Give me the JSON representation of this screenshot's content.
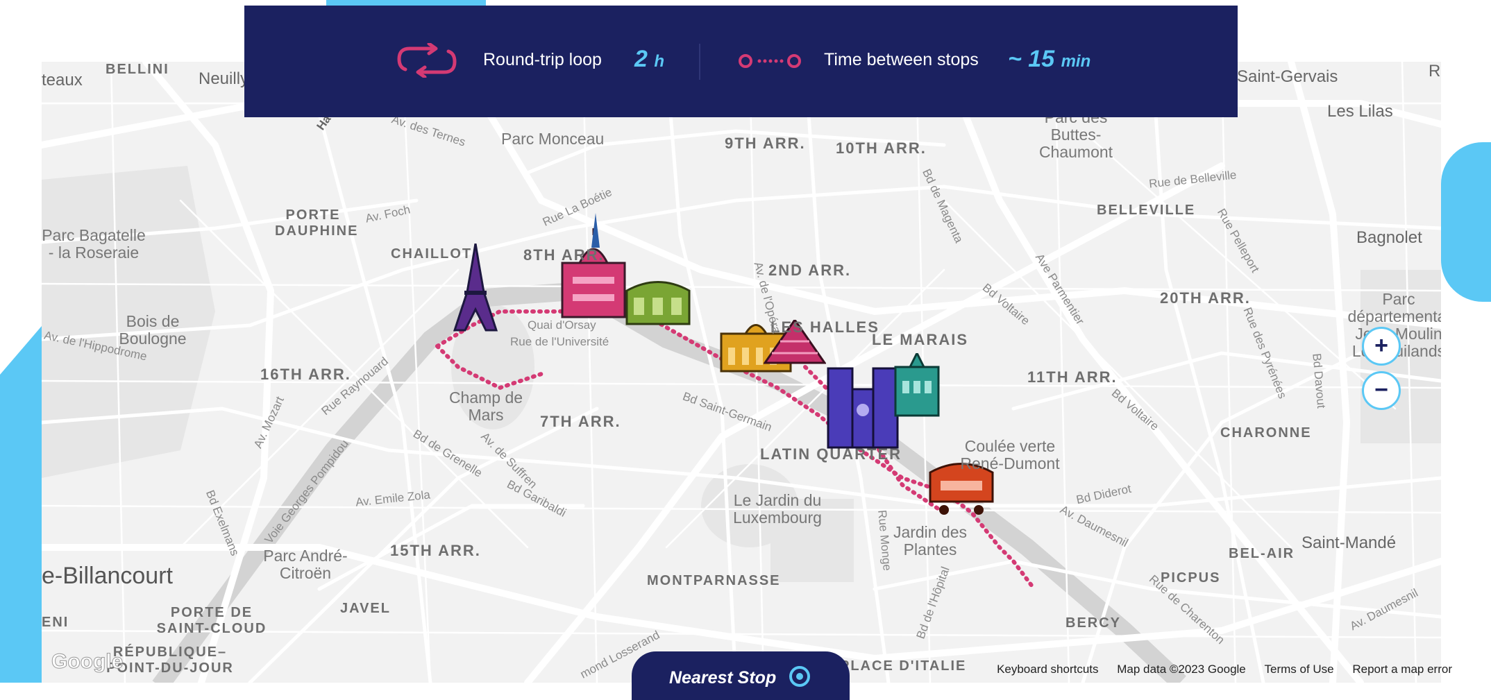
{
  "infobar": {
    "loop_label": "Round-trip loop",
    "loop_value": "2",
    "loop_unit": "h",
    "interval_label": "Time between stops",
    "interval_value": "~ 15",
    "interval_unit": "min",
    "loop_icon": "round-trip-icon",
    "interval_icon": "stops-dots-icon"
  },
  "colors": {
    "navy": "#1b2160",
    "accent": "#5bc8f5",
    "route": "#d43a74"
  },
  "map": {
    "districts": [
      "9TH ARR.",
      "10TH ARR.",
      "8TH ARR.",
      "2ND ARR.",
      "LES HALLES",
      "LE MARAIS",
      "16TH ARR.",
      "7TH ARR.",
      "LATIN QUARTER",
      "11TH ARR.",
      "20TH ARR.",
      "15TH ARR.",
      "MONTPARNASSE",
      "BELLEVILLE",
      "CHARONNE",
      "BEL-AIR",
      "PICPUS",
      "BERCY",
      "CHAILLOT",
      "JAVEL"
    ],
    "places": [
      "Parc Monceau",
      "Parc des Buttes-Chaumont",
      "Parc Bagatelle - la Roseraie",
      "Bois de Boulogne",
      "Champ de Mars",
      "Coulée verte René-Dumont",
      "Le Jardin du Luxembourg",
      "Jardin des Plantes",
      "Parc André-Citroën",
      "Parc départemental Jean-Moulin Les Guilands"
    ],
    "cities": [
      "Saint-Gervais",
      "Les Lilas",
      "Bagnolet",
      "Saint-Mandé",
      "BELLINI",
      "Neuilly",
      "teaux",
      "PORTE DAUPHINE",
      "PORTE DE SAINT-CLOUD",
      "RÉPUBLIQUE– POINT-DU-JOUR",
      "ENI",
      "e-Billancourt",
      "PLACE D'ITALIE",
      "R"
    ],
    "streets": [
      "Av. des Ternes",
      "Av. Foch",
      "Rue La Boétie",
      "Av. de l'Opéra",
      "Bd de Magenta",
      "Rue de Belleville",
      "Rue Pelleport",
      "Bd Voltaire",
      "Ave Parmentier",
      "Quai d'Orsay",
      "Rue de l'Université",
      "Av. de l'Hippodrome",
      "Rue Raynouard",
      "Av. Mozart",
      "Voie Georges Pompidou",
      "Bd de Grenelle",
      "Av. de Suffren",
      "Bd Garibaldi",
      "Bd Saint-Germain",
      "Av. Emile Zola",
      "Bd Exelmans",
      "Rue Monge",
      "Bd de l'Hôpital",
      "Rue des Pyrénées",
      "Bd Davout",
      "Bd Voltaire",
      "Bd Diderot",
      "Av. Daumesnil",
      "Rue de Charenton",
      "Av. Daumesnil",
      "mond Losserand",
      "Ha"
    ],
    "landmarks": [
      "eiffel-tower-icon",
      "grand-palais-icon",
      "obelisk-icon",
      "orsay-museum-icon",
      "institut-de-france-icon",
      "louvre-pyramid-icon",
      "notre-dame-icon",
      "hotel-de-ville-icon",
      "gare-de-lyon-icon"
    ]
  },
  "zoom": {
    "in": "+",
    "out": "−"
  },
  "nearest_stop": {
    "label": "Nearest Stop",
    "icon": "location-target-icon"
  },
  "google_logo": "Google",
  "footer": {
    "shortcuts": "Keyboard shortcuts",
    "mapdata": "Map data ©2023 Google",
    "terms": "Terms of Use",
    "report": "Report a map error"
  }
}
